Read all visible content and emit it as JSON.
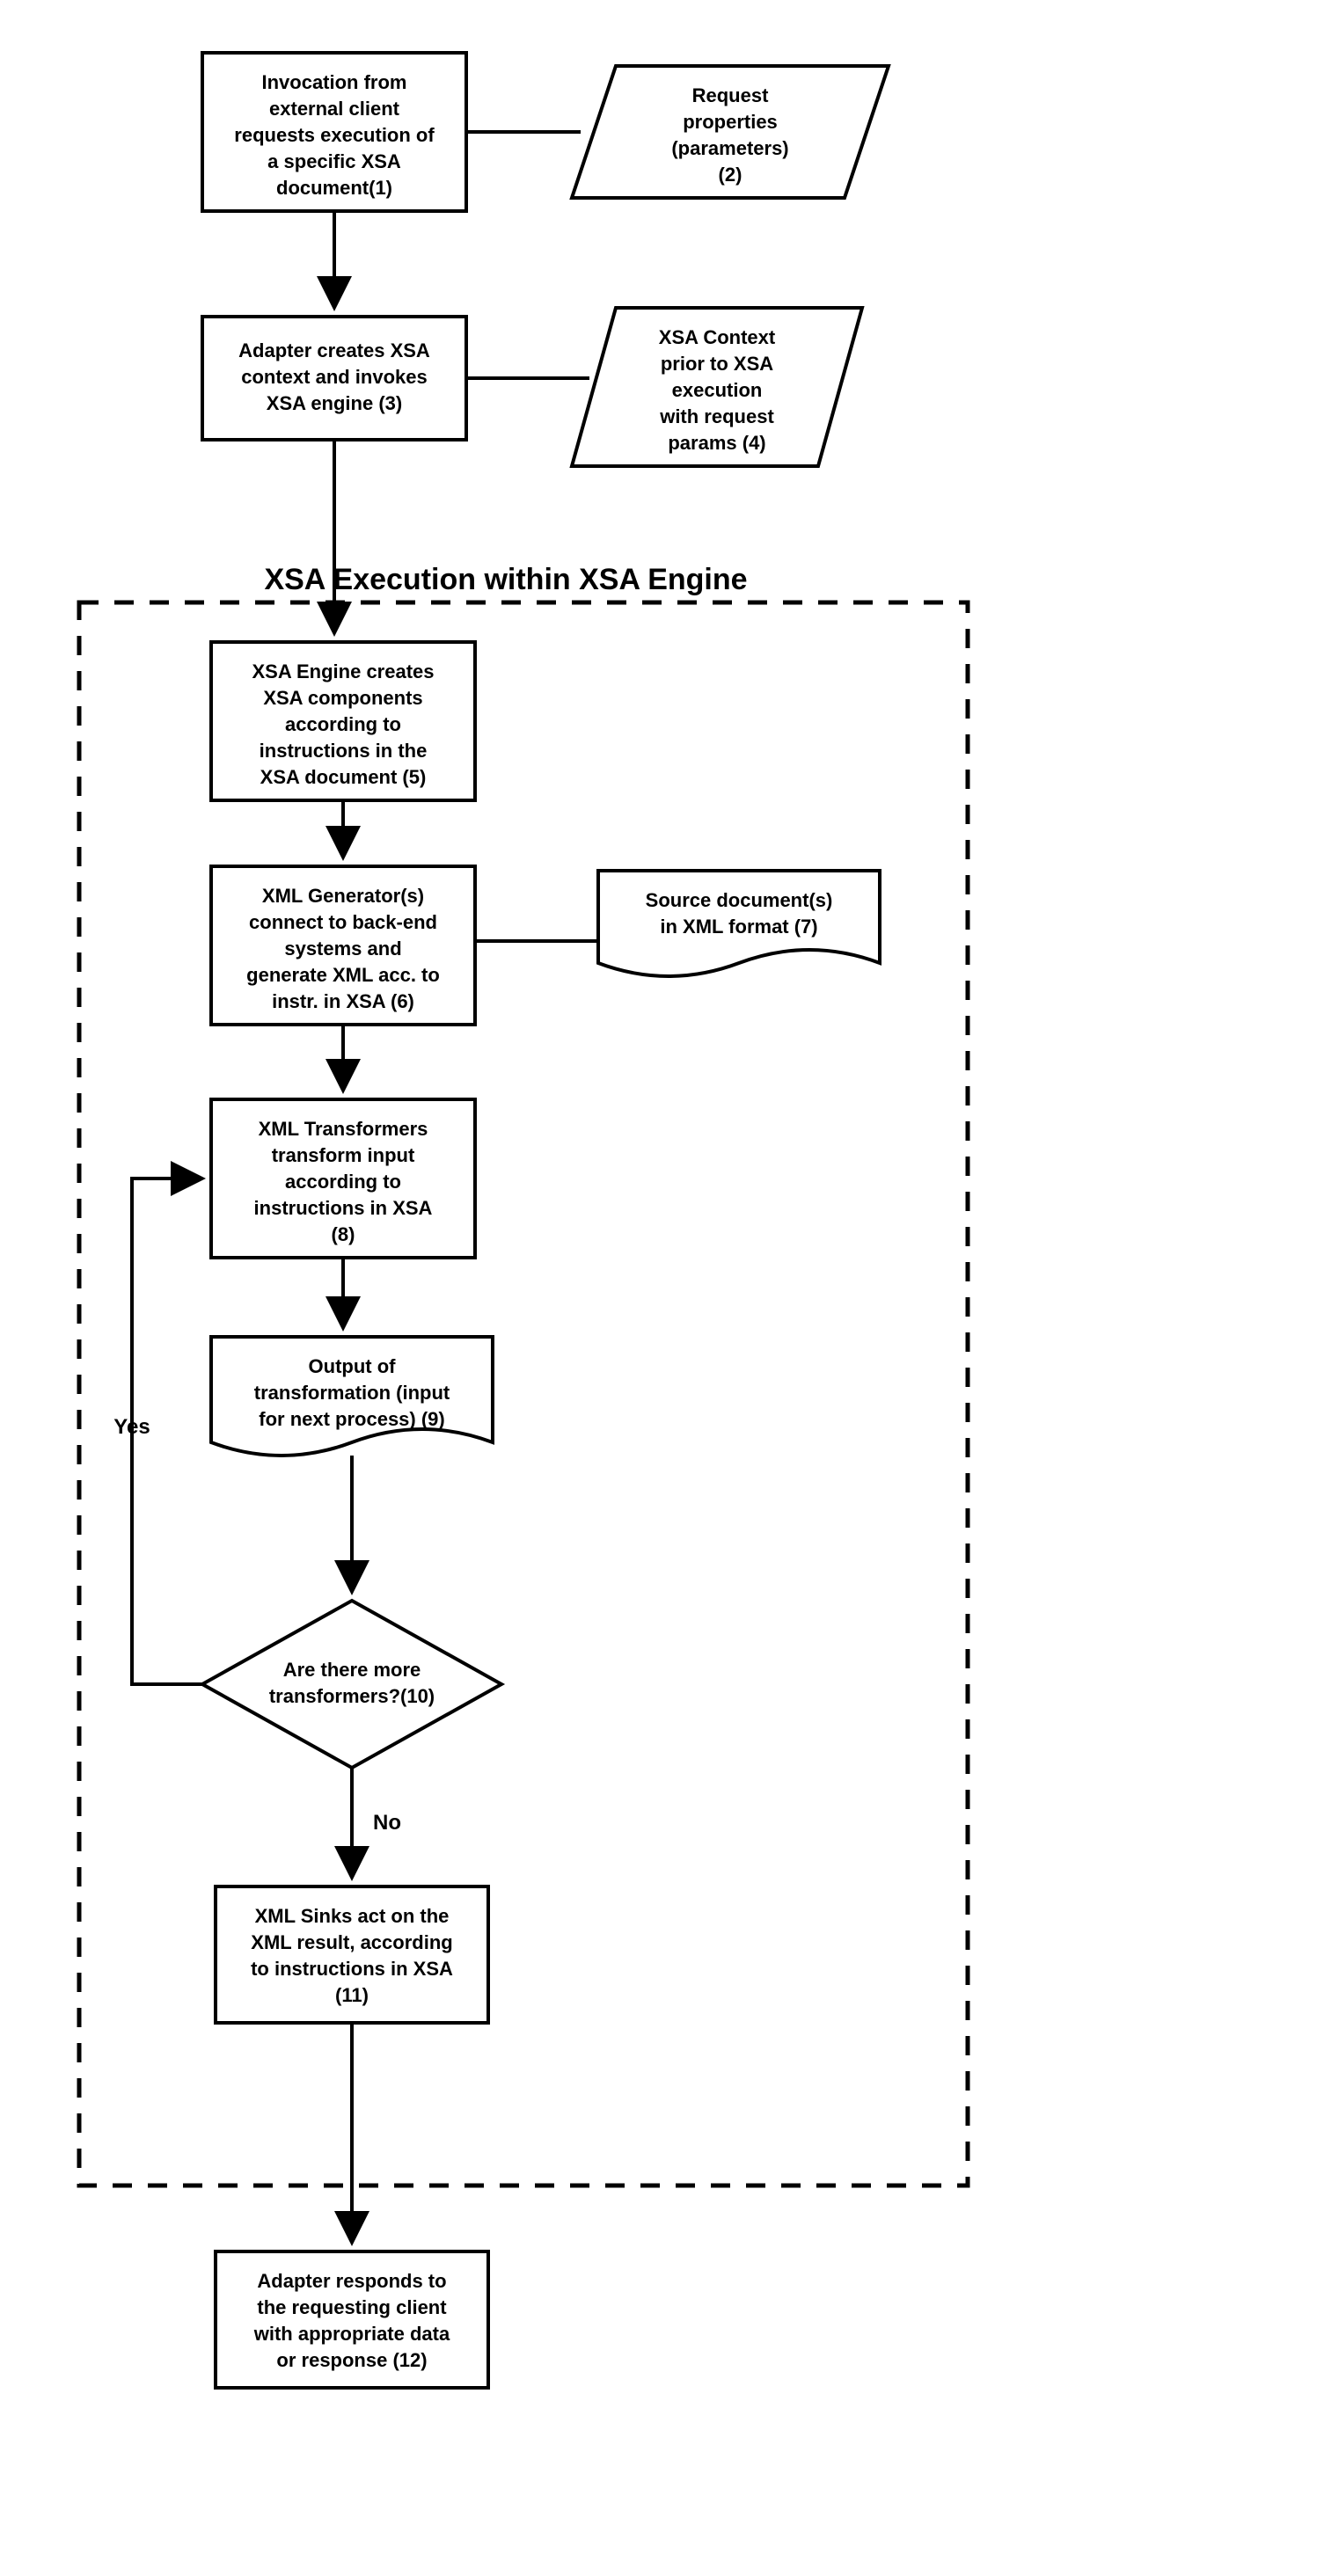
{
  "boxes": {
    "b1": {
      "l1": "Invocation from",
      "l2": "external client",
      "l3": "requests execution of",
      "l4": "a specific XSA",
      "l5": "document(1)"
    },
    "b2": {
      "l1": "Request",
      "l2": "properties",
      "l3": "(parameters)",
      "l4": "(2)"
    },
    "b3": {
      "l1": "Adapter creates XSA",
      "l2": "context and invokes",
      "l3": "XSA engine (3)"
    },
    "b4": {
      "l1": "XSA Context",
      "l2": "prior to XSA",
      "l3": "execution",
      "l4": "with request",
      "l5": "params (4)"
    },
    "title": "XSA Execution within XSA Engine",
    "b5": {
      "l1": "XSA Engine creates",
      "l2": "XSA components",
      "l3": "according to",
      "l4": "instructions in the",
      "l5": "XSA document (5)"
    },
    "b6": {
      "l1": "XML Generator(s)",
      "l2": "connect to back-end",
      "l3": "systems and",
      "l4": "generate XML acc. to",
      "l5": "instr. in XSA (6)"
    },
    "b7": {
      "l1": "Source document(s)",
      "l2": "in XML format (7)"
    },
    "b8": {
      "l1": "XML Transformers",
      "l2": "transform input",
      "l3": "according to",
      "l4": "instructions in XSA",
      "l5": "(8)"
    },
    "b9": {
      "l1": "Output of",
      "l2": "transformation (input",
      "l3": "for next process) (9)"
    },
    "b10": {
      "l1": "Are there more",
      "l2": "transformers?(10)"
    },
    "yes": "Yes",
    "no": "No",
    "b11": {
      "l1": "XML Sinks act on the",
      "l2": "XML result, according",
      "l3": "to instructions in XSA",
      "l4": "(11)"
    },
    "b12": {
      "l1": "Adapter responds to",
      "l2": "the requesting client",
      "l3": "with appropriate data",
      "l4": "or response (12)"
    }
  }
}
